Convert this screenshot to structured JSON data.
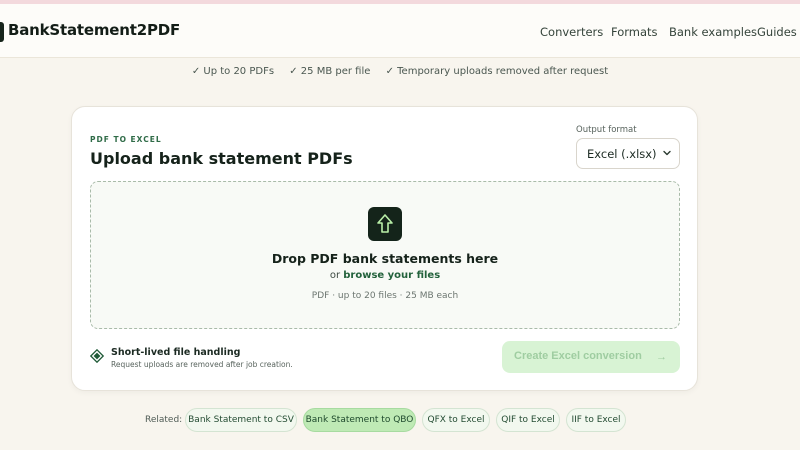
{
  "header": {
    "brand": "BankStatement2PDF",
    "nav": [
      "Converters",
      "Formats",
      "Bank examples",
      "Guides"
    ]
  },
  "features": [
    "✓ Up to 20 PDFs",
    "✓ 25 MB per file",
    "✓ Temporary uploads removed after request"
  ],
  "card": {
    "eyebrow": "PDF TO EXCEL",
    "title": "Upload bank statement PDFs",
    "output_format_label": "Output format",
    "output_format_value": "Excel (.xlsx)",
    "dropzone": {
      "title": "Drop PDF bank statements here",
      "or_text": "or",
      "browse_label": "browse your files",
      "hint": "PDF · up to 20 files · 25 MB each"
    },
    "handling": {
      "title": "Short-lived file handling",
      "subtitle": "Request uploads are removed after job creation."
    },
    "cta_label": "Create Excel conversion",
    "cta_arrow": "→"
  },
  "related": {
    "label": "Related:",
    "chips": [
      "Bank Statement to CSV",
      "Bank Statement to QBO",
      "QFX to Excel",
      "QIF to Excel",
      "IIF to Excel"
    ],
    "active_index": 1
  },
  "colors": {
    "accent_dark": "#14241a",
    "accent_green": "#23623c",
    "cta_bg": "#d8f3d4",
    "chip_active": "#bfeab5",
    "page_bg": "#f8f5ee"
  }
}
